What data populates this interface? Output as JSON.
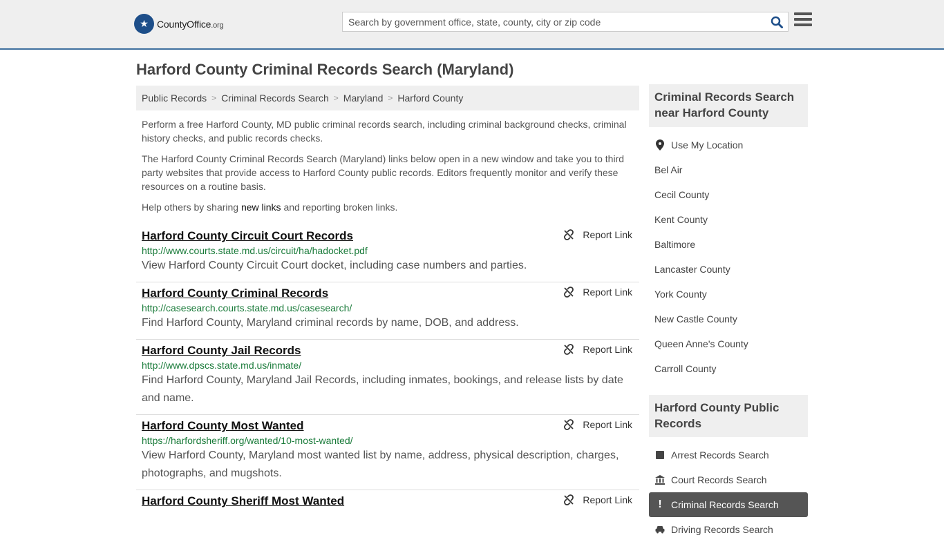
{
  "header": {
    "logo_text": "CountyOffice",
    "logo_suffix": ".org",
    "search_placeholder": "Search by government office, state, county, city or zip code"
  },
  "page": {
    "title": "Harford County Criminal Records Search (Maryland)"
  },
  "breadcrumb": [
    "Public Records",
    "Criminal Records Search",
    "Maryland",
    "Harford County"
  ],
  "intro": {
    "p1": "Perform a free Harford County, MD public criminal records search, including criminal background checks, criminal history checks, and public records checks.",
    "p2": "The Harford County Criminal Records Search (Maryland) links below open in a new window and take you to third party websites that provide access to Harford County public records. Editors frequently monitor and verify these resources on a routine basis.",
    "p3_before": "Help others by sharing ",
    "p3_link": "new links",
    "p3_after": " and reporting broken links."
  },
  "report_label": "Report Link",
  "records": [
    {
      "title": "Harford County Circuit Court Records",
      "url": "http://www.courts.state.md.us/circuit/ha/hadocket.pdf",
      "desc": "View Harford County Circuit Court docket, including case numbers and parties."
    },
    {
      "title": "Harford County Criminal Records",
      "url": "http://casesearch.courts.state.md.us/casesearch/",
      "desc": "Find Harford County, Maryland criminal records by name, DOB, and address."
    },
    {
      "title": "Harford County Jail Records",
      "url": "http://www.dpscs.state.md.us/inmate/",
      "desc": "Find Harford County, Maryland Jail Records, including inmates, bookings, and release lists by date and name."
    },
    {
      "title": "Harford County Most Wanted",
      "url": "https://harfordsheriff.org/wanted/10-most-wanted/",
      "desc": "View Harford County, Maryland most wanted list by name, address, physical description, charges, photographs, and mugshots."
    },
    {
      "title": "Harford County Sheriff Most Wanted",
      "url": "",
      "desc": ""
    }
  ],
  "sidebar": {
    "nearby_title": "Criminal Records Search near Harford County",
    "use_location": "Use My Location",
    "nearby": [
      "Bel Air",
      "Cecil County",
      "Kent County",
      "Baltimore",
      "Lancaster County",
      "York County",
      "New Castle County",
      "Queen Anne's County",
      "Carroll County"
    ],
    "public_title": "Harford County Public Records",
    "public": [
      {
        "label": "Arrest Records Search",
        "icon": "square-icon"
      },
      {
        "label": "Court Records Search",
        "icon": "courthouse-icon"
      },
      {
        "label": "Criminal Records Search",
        "icon": "exclamation-icon",
        "active": true
      },
      {
        "label": "Driving Records Search",
        "icon": "car-icon"
      }
    ]
  }
}
